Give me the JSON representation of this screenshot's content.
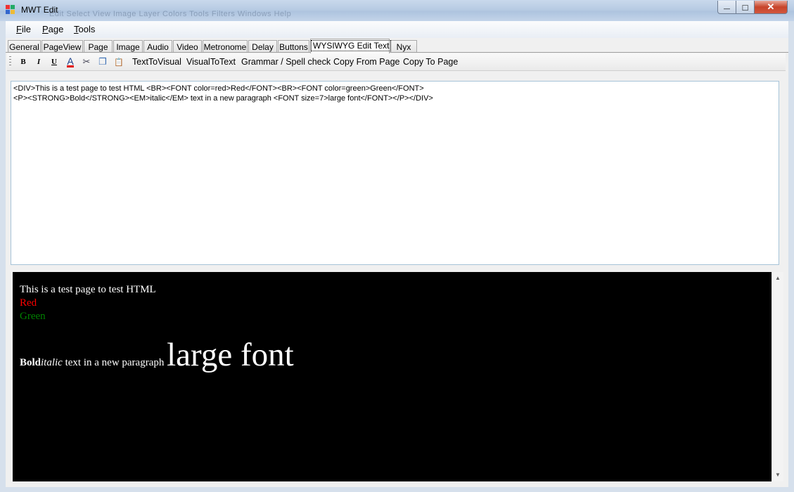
{
  "window": {
    "title": "MWT Edit",
    "ghost_menu": "Edit   Select   View   Image   Layer   Colors   Tools   Filters   Windows   Help",
    "controls": {
      "minimize": "—",
      "maximize": "□",
      "close": "✕"
    }
  },
  "menu": [
    {
      "key": "F",
      "rest": "ile"
    },
    {
      "key": "P",
      "rest": "age"
    },
    {
      "key": "T",
      "rest": "ools"
    }
  ],
  "tabs": [
    "General",
    "PageView",
    "Page",
    "Image",
    "Audio",
    "Video",
    "Metronome",
    "Delay",
    "Buttons",
    "WYSIWYG Edit Text",
    "Nyx"
  ],
  "active_tab": "WYSIWYG Edit Text",
  "toolbar": {
    "bold": "B",
    "italic": "I",
    "underline": "U",
    "font_color": "A",
    "cut_icon": "✂",
    "copy_icon": "❐",
    "paste_icon": "📋",
    "text_to_visual": "TextToVisual",
    "visual_to_text": "VisualToText",
    "grammar": "Grammar / Spell check",
    "copy_from_page": "Copy From Page",
    "copy_to_page": "Copy To Page"
  },
  "source_text": "<DIV>This is a test page to test HTML <BR><FONT color=red>Red</FONT><BR><FONT color=green>Green</FONT>\n<P><STRONG>Bold</STRONG><EM>italic</EM> text in a new paragraph <FONT size=7>large font</FONT></P></DIV>",
  "preview": {
    "line1": "This is a test page to test HTML",
    "red": "Red",
    "green": "Green",
    "bold": "Bold",
    "italic": "italic",
    "normal": " text in a new paragraph ",
    "large": "large font",
    "colors": {
      "red": "#ff0000",
      "green": "#008000",
      "text": "#ffffff"
    }
  },
  "scroll": {
    "up": "▲",
    "down": "▼"
  }
}
